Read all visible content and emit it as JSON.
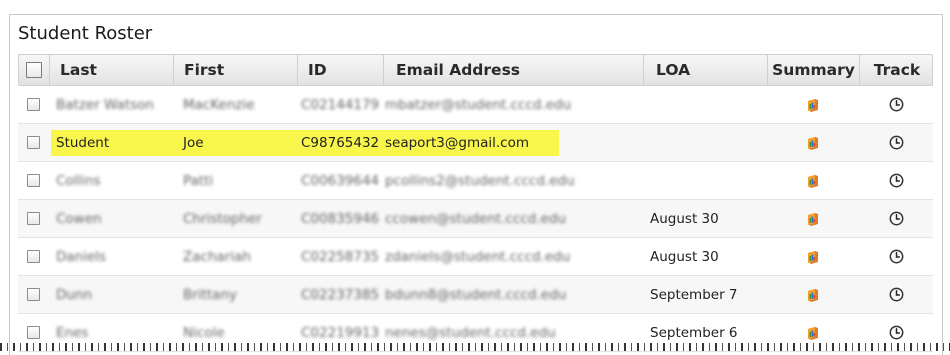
{
  "title": "Student Roster",
  "columns": {
    "last": "Last",
    "first": "First",
    "id": "ID",
    "email": "Email Address",
    "loa": "LOA",
    "summary": "Summary",
    "track": "Track"
  },
  "rows": [
    {
      "last": "Batzer Watson",
      "first": "MacKenzie",
      "id": "C02144179",
      "email": "mbatzer@student.cccd.edu",
      "loa": "",
      "blurred": true
    },
    {
      "last": "Student",
      "first": "Joe",
      "id": "C98765432",
      "email": "seaport3@gmail.com",
      "loa": "",
      "blurred": false,
      "highlighted": true
    },
    {
      "last": "Collins",
      "first": "Patti",
      "id": "C00639644",
      "email": "pcollins2@student.cccd.edu",
      "loa": "",
      "blurred": true
    },
    {
      "last": "Cowen",
      "first": "Christopher",
      "id": "C00835946",
      "email": "ccowen@student.cccd.edu",
      "loa": "August 30",
      "blurred": true
    },
    {
      "last": "Daniels",
      "first": "Zachariah",
      "id": "C02258735",
      "email": "zdaniels@student.cccd.edu",
      "loa": "August 30",
      "blurred": true
    },
    {
      "last": "Dunn",
      "first": "Brittany",
      "id": "C02237385",
      "email": "bdunn8@student.cccd.edu",
      "loa": "September 7",
      "blurred": true
    },
    {
      "last": "Enes",
      "first": "Nicole",
      "id": "C02219913",
      "email": "nenes@student.cccd.edu",
      "loa": "September 6",
      "blurred": true
    }
  ],
  "icons": {
    "summary": "report-icon",
    "track": "clock-icon"
  },
  "colors": {
    "highlight": "#f8f64a",
    "header_bg": "#e6e6e6",
    "border": "#cfcfcf"
  }
}
